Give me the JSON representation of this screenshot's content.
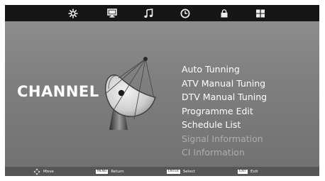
{
  "tabs": [
    {
      "icon": "picture-settings-icon",
      "name": "Picture"
    },
    {
      "icon": "monitor-icon",
      "name": "Display"
    },
    {
      "icon": "music-note-icon",
      "name": "Sound"
    },
    {
      "icon": "clock-icon",
      "name": "Time"
    },
    {
      "icon": "lock-icon",
      "name": "Lock"
    },
    {
      "icon": "grid-icon",
      "name": "Setup"
    }
  ],
  "active_tab": "Channel",
  "section_title": "CHANNEL",
  "menu_items": [
    {
      "label": "Auto Tunning",
      "enabled": true
    },
    {
      "label": "ATV Manual Tuning",
      "enabled": true
    },
    {
      "label": "DTV Manual Tuning",
      "enabled": true
    },
    {
      "label": "Programme Edit",
      "enabled": true
    },
    {
      "label": "Schedule List",
      "enabled": true
    },
    {
      "label": "Signal Information",
      "enabled": false
    },
    {
      "label": "CI Information",
      "enabled": false
    }
  ],
  "hints": {
    "move": {
      "icon": "directional-arrows-icon",
      "label": "Move"
    },
    "return": {
      "key": "MENU",
      "label": "Return"
    },
    "select": {
      "key": "ENTER",
      "label": "Select"
    },
    "exit": {
      "key": "EXIT",
      "label": "Exit"
    }
  },
  "colors": {
    "topbar": "#161616",
    "background": "#7f7f7f",
    "bottombar": "#565656",
    "text": "#ffffff",
    "disabled_text": "#adadad",
    "icon": "#ececec"
  }
}
